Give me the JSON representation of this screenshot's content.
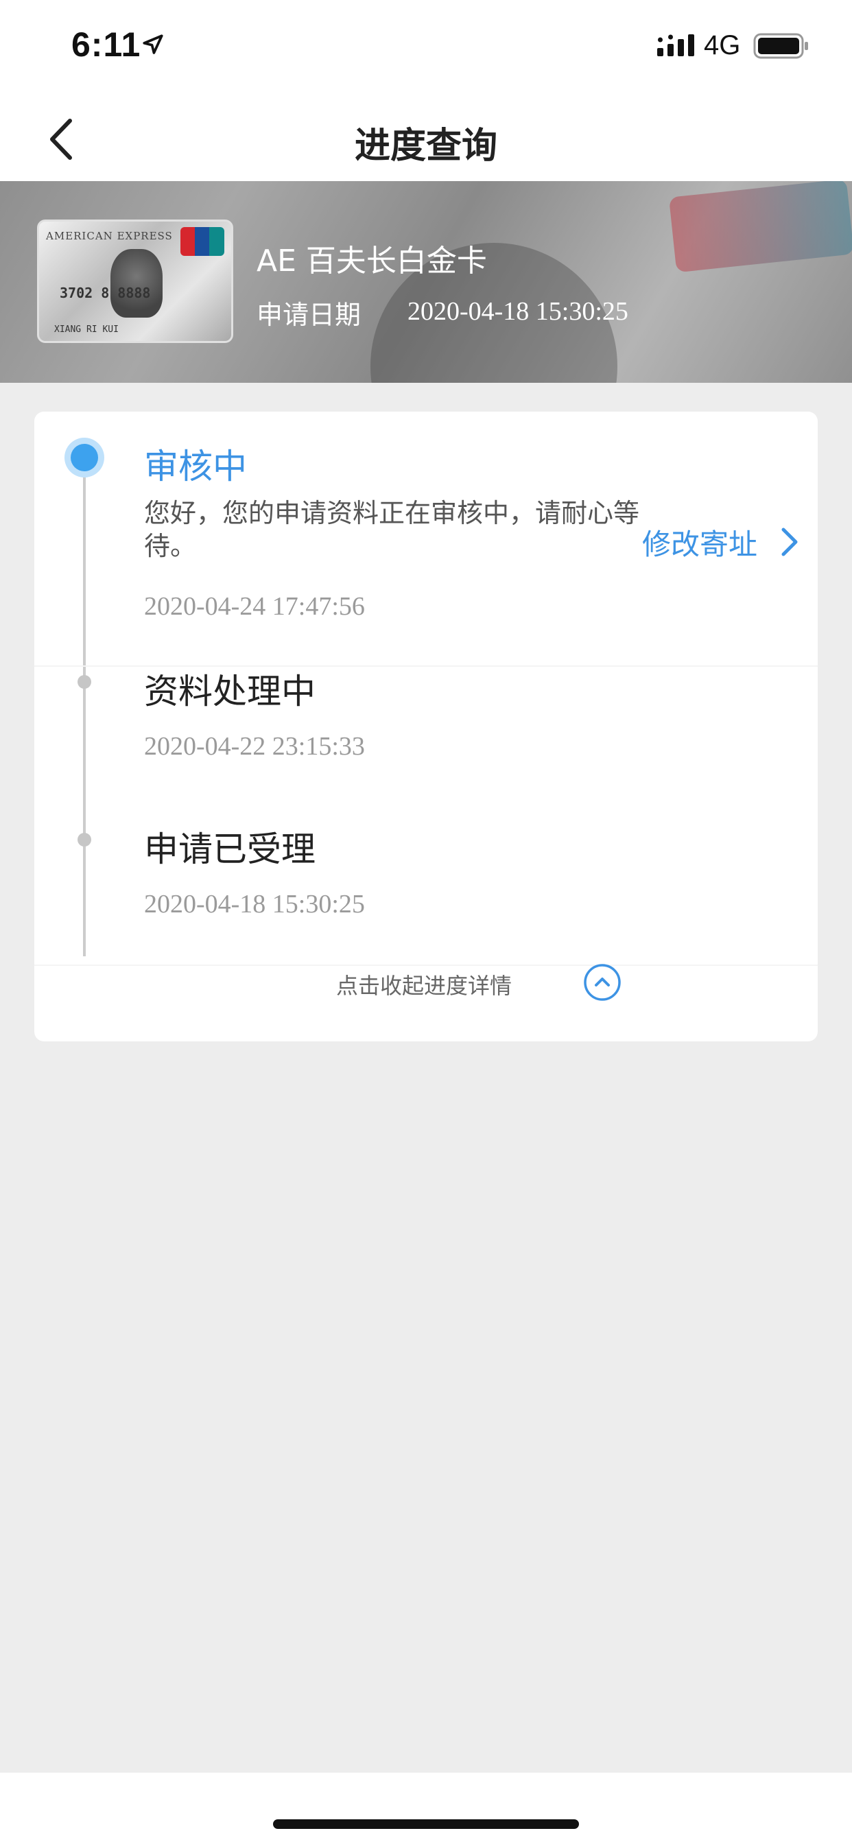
{
  "status_bar": {
    "time": "6:11",
    "network": "4G",
    "icons": [
      "location-arrow-icon",
      "signal-icon",
      "battery-icon"
    ]
  },
  "nav": {
    "title": "进度查询",
    "back_icon": "chevron-left-icon"
  },
  "card": {
    "name": "AE 百夫长白金卡",
    "apply_date_label": "申请日期",
    "apply_date_value": "2020-04-18 15:30:25",
    "image": {
      "brand": "AMERICAN EXPRESS",
      "number": "3702 8 8888",
      "holder": "XIANG RI KUI"
    }
  },
  "progress": {
    "steps": [
      {
        "title": "审核中",
        "description": "您好，您的申请资料正在审核中，请耐心等待。",
        "time": "2020-04-24 17:47:56",
        "active": true
      },
      {
        "title": "资料处理中",
        "time": "2020-04-22 23:15:33",
        "active": false
      },
      {
        "title": "申请已受理",
        "time": "2020-04-18 15:30:25",
        "active": false
      }
    ],
    "modify_link": "修改寄址",
    "collapse_label": "点击收起进度详情"
  },
  "colors": {
    "accent": "#3d93e4",
    "background": "#ededed",
    "card_bg": "#ffffff"
  }
}
